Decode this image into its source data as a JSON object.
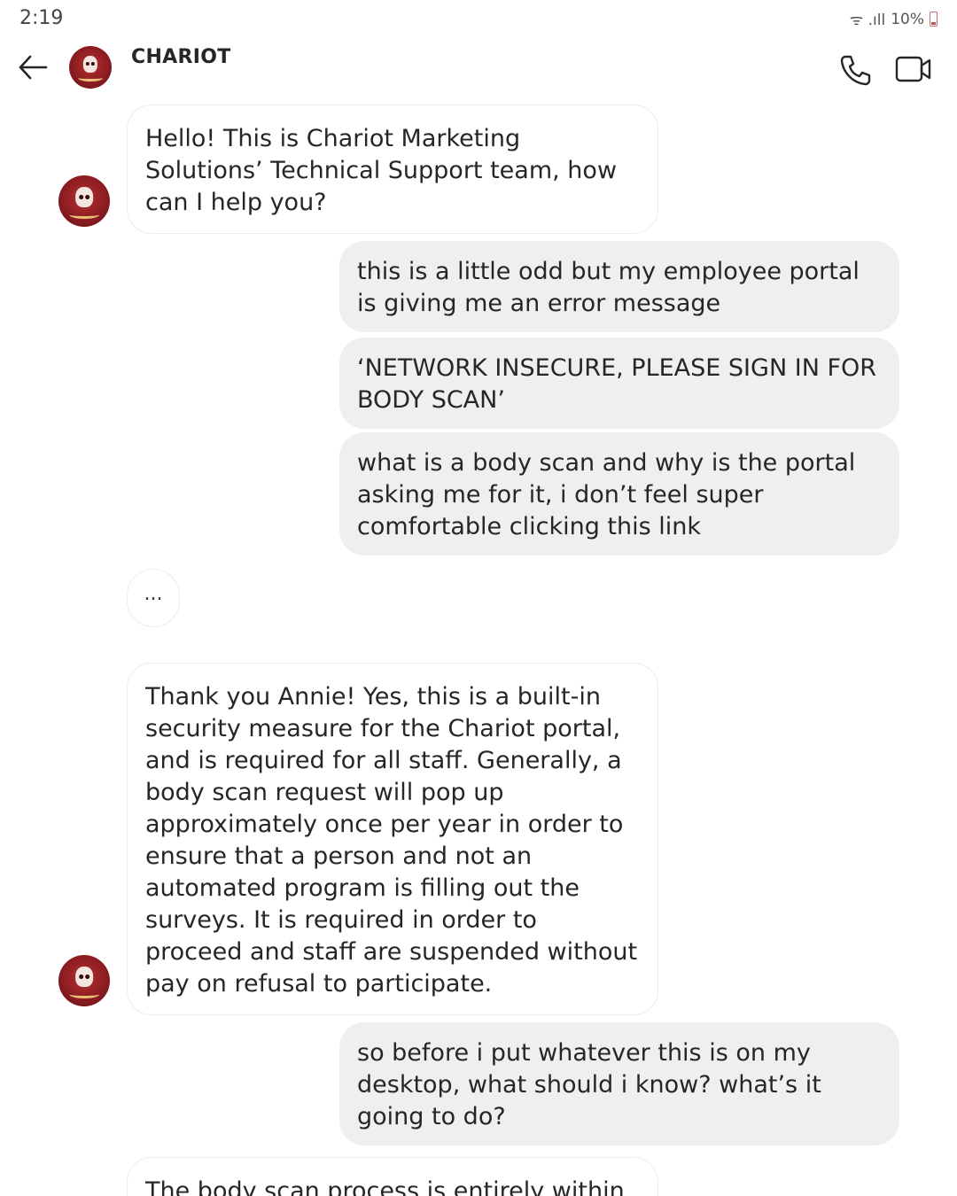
{
  "status": {
    "time": "2:19",
    "signal_text": "ᯤ .ıll",
    "battery": "10%"
  },
  "header": {
    "contact_name": "CHARIOT",
    "back_icon": "arrow-left-icon",
    "call_icon": "phone-icon",
    "video_icon": "video-camera-icon"
  },
  "messages": [
    {
      "direction": "in",
      "text": "Hello! This is Chariot Marketing Solutions’ Technical Support team, how can I help you?"
    },
    {
      "direction": "out",
      "text": "this is a little odd but my employee portal is giving me an error message"
    },
    {
      "direction": "out",
      "text": "‘NETWORK INSECURE, PLEASE SIGN IN FOR BODY SCAN’"
    },
    {
      "direction": "out",
      "text": "what is a body scan and why is the portal asking me for it, i don’t feel super comfortable clicking this link"
    },
    {
      "direction": "in",
      "text": "..."
    },
    {
      "direction": "in",
      "text": "Thank you Annie! Yes, this is a built-in security measure for the Chariot portal, and is required for all staff. Generally, a body scan request will pop up approximately once per year in order to ensure that a person and not an automated program is filling out the surveys. It is required in order to proceed and staff are suspended without pay on refusal to participate."
    },
    {
      "direction": "out",
      "text": "so before i put whatever this is on my desktop, what should i know? what’s it going to do?"
    },
    {
      "direction": "in",
      "text": "The body scan process is entirely within"
    }
  ],
  "colors": {
    "outgoing_bubble": "#efefef",
    "incoming_border": "#ececec",
    "avatar_red": "#8e1d22"
  }
}
